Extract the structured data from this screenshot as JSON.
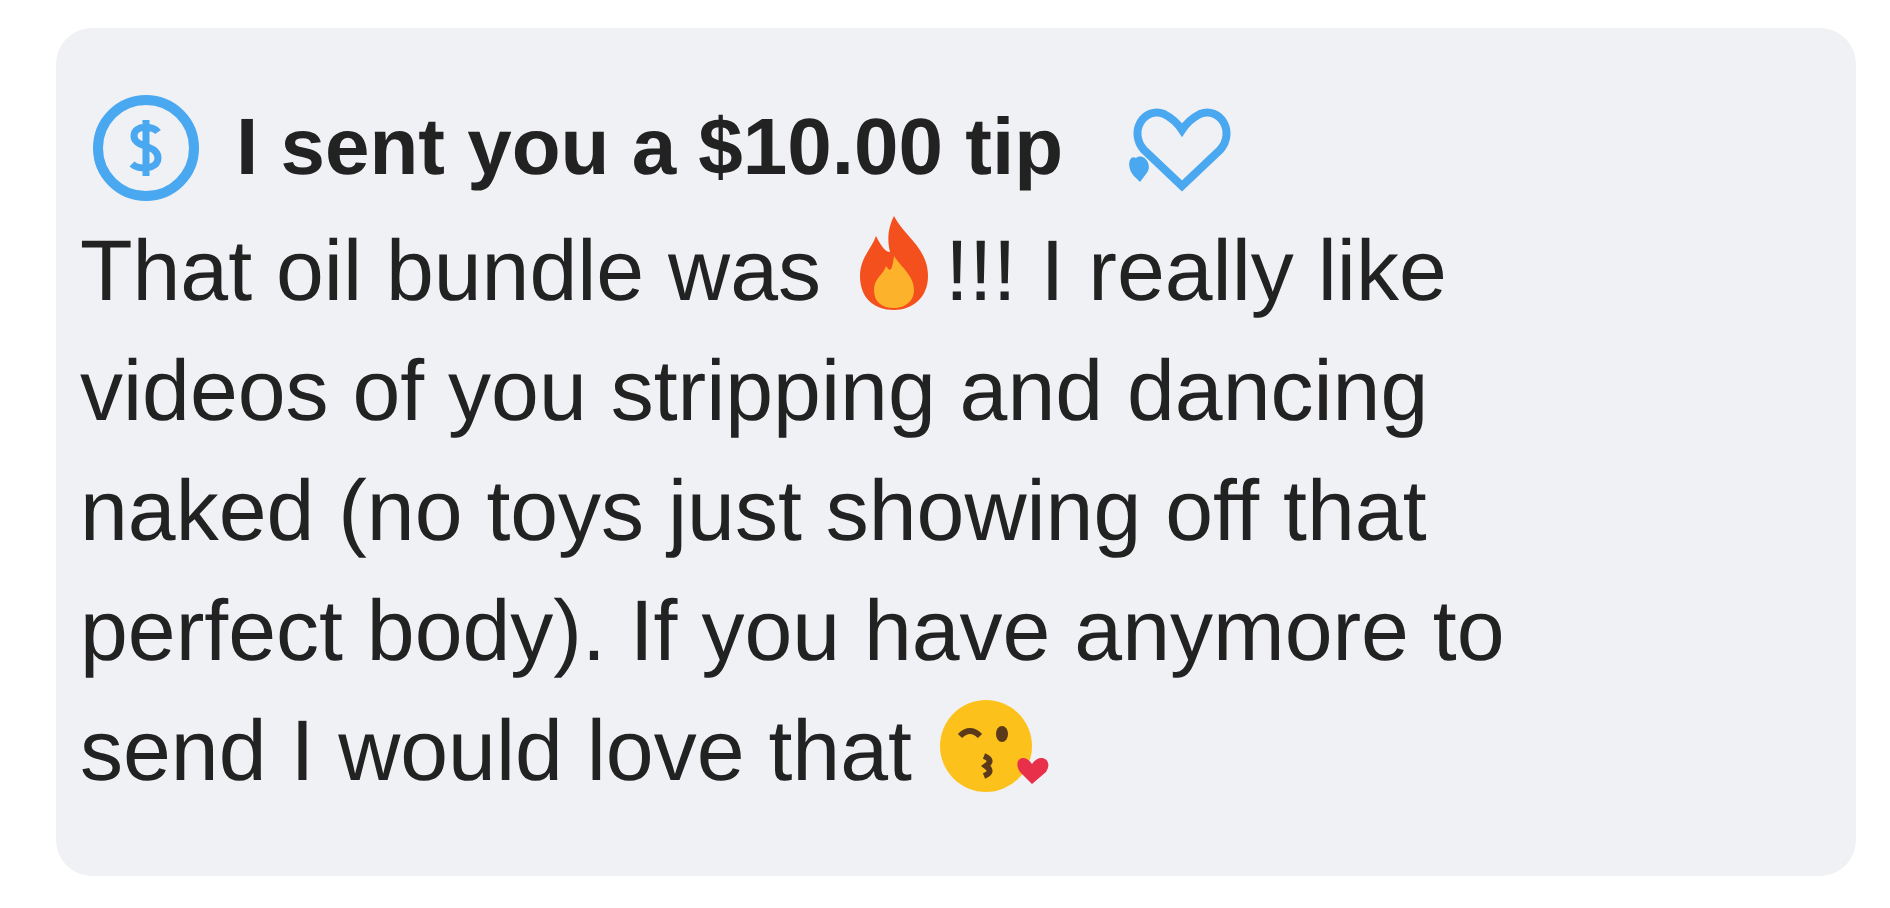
{
  "message": {
    "tip_title": "I sent you a $10.00 tip",
    "lines": [
      [
        {
          "kind": "text",
          "text": "That oil bundle was "
        },
        {
          "kind": "fire"
        },
        {
          "kind": "text",
          "text": "!!! I really like"
        }
      ],
      [
        {
          "kind": "text",
          "text": "videos of you stripping and dancing"
        }
      ],
      [
        {
          "kind": "text",
          "text": "naked (no toys just showing off that"
        }
      ],
      [
        {
          "kind": "text",
          "text": "perfect body). If you have anymore to"
        }
      ],
      [
        {
          "kind": "text",
          "text": "send I would love that "
        },
        {
          "kind": "kiss"
        }
      ]
    ]
  }
}
